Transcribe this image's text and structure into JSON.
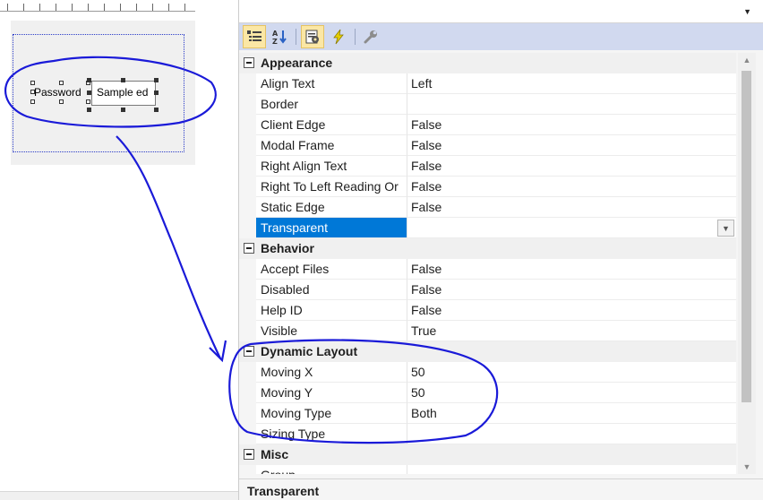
{
  "designer": {
    "static_label": "Password",
    "edit_text": "Sample ed"
  },
  "toolbar": {
    "buttons": [
      {
        "icon": "categorized-icon",
        "active": true
      },
      {
        "icon": "alphabetical-sort-icon",
        "active": false
      },
      {
        "icon": "properties-page-icon",
        "active": true
      },
      {
        "icon": "events-lightning-icon",
        "active": false
      },
      {
        "icon": "property-pages-wrench-icon",
        "active": false
      }
    ]
  },
  "grid": {
    "categories": [
      {
        "name": "Appearance",
        "properties": [
          {
            "name": "Align Text",
            "value": "Left"
          },
          {
            "name": "Border",
            "value": ""
          },
          {
            "name": "Client Edge",
            "value": "False"
          },
          {
            "name": "Modal Frame",
            "value": "False"
          },
          {
            "name": "Right Align Text",
            "value": "False"
          },
          {
            "name": "Right To Left Reading Or",
            "value": "False"
          },
          {
            "name": "Static Edge",
            "value": "False"
          },
          {
            "name": "Transparent",
            "value": "",
            "selected": true
          }
        ]
      },
      {
        "name": "Behavior",
        "properties": [
          {
            "name": "Accept Files",
            "value": "False"
          },
          {
            "name": "Disabled",
            "value": "False"
          },
          {
            "name": "Help ID",
            "value": "False"
          },
          {
            "name": "Visible",
            "value": "True"
          }
        ]
      },
      {
        "name": "Dynamic Layout",
        "properties": [
          {
            "name": "Moving X",
            "value": "50"
          },
          {
            "name": "Moving Y",
            "value": "50"
          },
          {
            "name": "Moving Type",
            "value": "Both"
          },
          {
            "name": "Sizing Type",
            "value": ""
          }
        ]
      },
      {
        "name": "Misc",
        "properties": [
          {
            "name": "Group",
            "value": ""
          }
        ]
      }
    ]
  },
  "description": {
    "title": "Transparent"
  },
  "colors": {
    "toolbar_bg": "#d1d9ef",
    "selection": "#0078d7",
    "annotation_ink": "#1a1ad8",
    "dialog_bg": "#f0f0f0"
  }
}
